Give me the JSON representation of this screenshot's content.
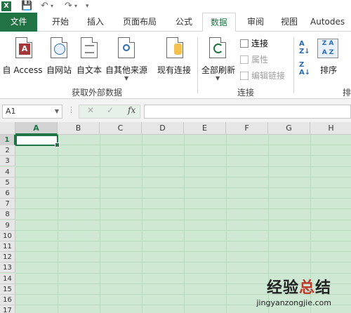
{
  "quick_access": {
    "logo": "X",
    "icons": [
      "save-icon",
      "undo-icon",
      "redo-icon",
      "customize-icon"
    ]
  },
  "tabs": [
    {
      "label": "文件"
    },
    {
      "label": "开始"
    },
    {
      "label": "插入"
    },
    {
      "label": "页面布局"
    },
    {
      "label": "公式"
    },
    {
      "label": "数据"
    },
    {
      "label": "审阅"
    },
    {
      "label": "视图"
    },
    {
      "label": "Autodes"
    }
  ],
  "active_tab": "数据",
  "ribbon": {
    "external_data": {
      "group_label": "获取外部数据",
      "buttons": [
        {
          "label": "自 Access",
          "icon": "access-icon"
        },
        {
          "label": "自网站",
          "icon": "web-icon"
        },
        {
          "label": "自文本",
          "icon": "text-icon"
        },
        {
          "label": "自其他来源",
          "icon": "other-sources-icon"
        }
      ]
    },
    "existing_connections": {
      "label": "现有连接",
      "icon": "existing-connections-icon"
    },
    "connections": {
      "group_label": "连接",
      "refresh_all": "全部刷新",
      "items": [
        {
          "label": "连接",
          "enabled": true
        },
        {
          "label": "属性",
          "enabled": false
        },
        {
          "label": "编辑链接",
          "enabled": false
        }
      ]
    },
    "sort": {
      "label": "排序",
      "group_label_partial": "排"
    }
  },
  "formula_bar": {
    "name_box": "A1",
    "cancel": "✕",
    "enter": "✓",
    "fx": "fx",
    "value": ""
  },
  "grid": {
    "columns": [
      "A",
      "B",
      "C",
      "D",
      "E",
      "F",
      "G",
      "H"
    ],
    "rows": [
      "1",
      "2",
      "3",
      "4",
      "5",
      "6",
      "7",
      "8",
      "9",
      "10",
      "11",
      "12",
      "13",
      "14",
      "15",
      "16",
      "17"
    ],
    "selected_cell": "A1"
  },
  "watermark": {
    "title_black": "经验",
    "title_red": "总",
    "title_black2": "结",
    "url": "jingyanzongjie.com"
  },
  "colors": {
    "accent": "#217346",
    "grid_bg": "#cfe8d4"
  }
}
